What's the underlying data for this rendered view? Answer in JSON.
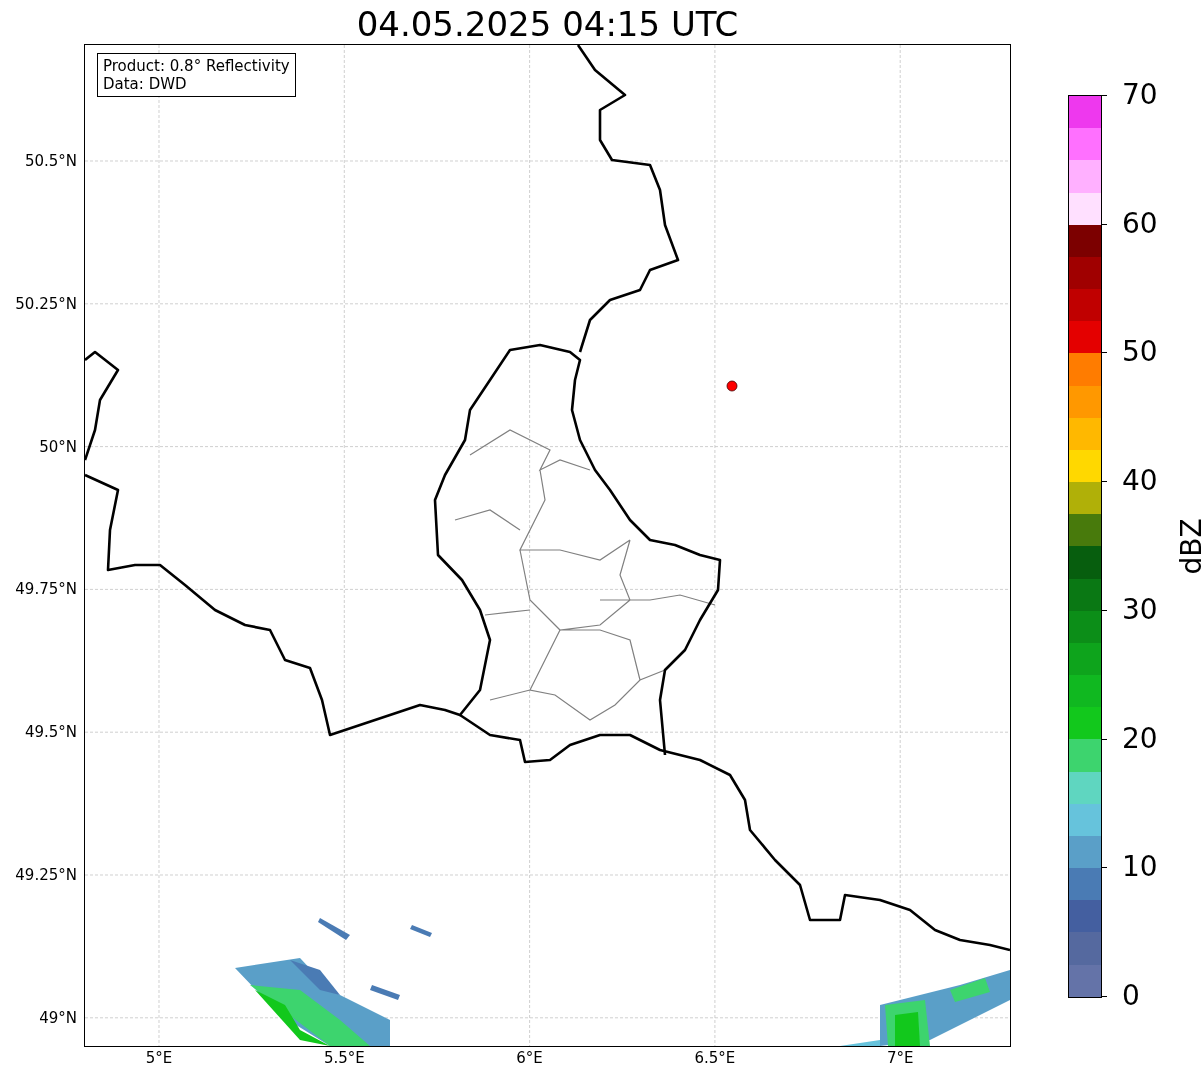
{
  "title": "04.05.2025 04:15 UTC",
  "info_box": {
    "lines": [
      "Product: 0.8° Reflectivity",
      "Data: DWD"
    ]
  },
  "map": {
    "lat_ticks": [
      "50.5°N",
      "50.25°N",
      "50°N",
      "49.75°N",
      "49.5°N",
      "49.25°N",
      "49°N"
    ],
    "lon_ticks": [
      "5°E",
      "5.5°E",
      "6°E",
      "6.5°E",
      "7°E"
    ],
    "marker": {
      "color": "#ff0000"
    }
  },
  "colorbar": {
    "label": "dBZ",
    "ticks": [
      "70",
      "60",
      "50",
      "40",
      "30",
      "20",
      "10",
      "0"
    ],
    "bands": [
      {
        "color": "#6473a8"
      },
      {
        "color": "#55699f"
      },
      {
        "color": "#445fa0"
      },
      {
        "color": "#4a7bb4"
      },
      {
        "color": "#5a9fc8"
      },
      {
        "color": "#66c3dc"
      },
      {
        "color": "#5fd6c0"
      },
      {
        "color": "#3dd46e"
      },
      {
        "color": "#12c81c"
      },
      {
        "color": "#10b820"
      },
      {
        "color": "#0ea41c"
      },
      {
        "color": "#0c8e18"
      },
      {
        "color": "#0a7814"
      },
      {
        "color": "#075e0e"
      },
      {
        "color": "#487a0c"
      },
      {
        "color": "#b0b008"
      },
      {
        "color": "#ffd800"
      },
      {
        "color": "#ffb800"
      },
      {
        "color": "#ff9800"
      },
      {
        "color": "#ff7c00"
      },
      {
        "color": "#e40000"
      },
      {
        "color": "#c00000"
      },
      {
        "color": "#a00000"
      },
      {
        "color": "#7c0000"
      },
      {
        "color": "#ffe0ff"
      },
      {
        "color": "#ffb0ff"
      },
      {
        "color": "#ff70ff"
      },
      {
        "color": "#ee38ee"
      }
    ]
  }
}
